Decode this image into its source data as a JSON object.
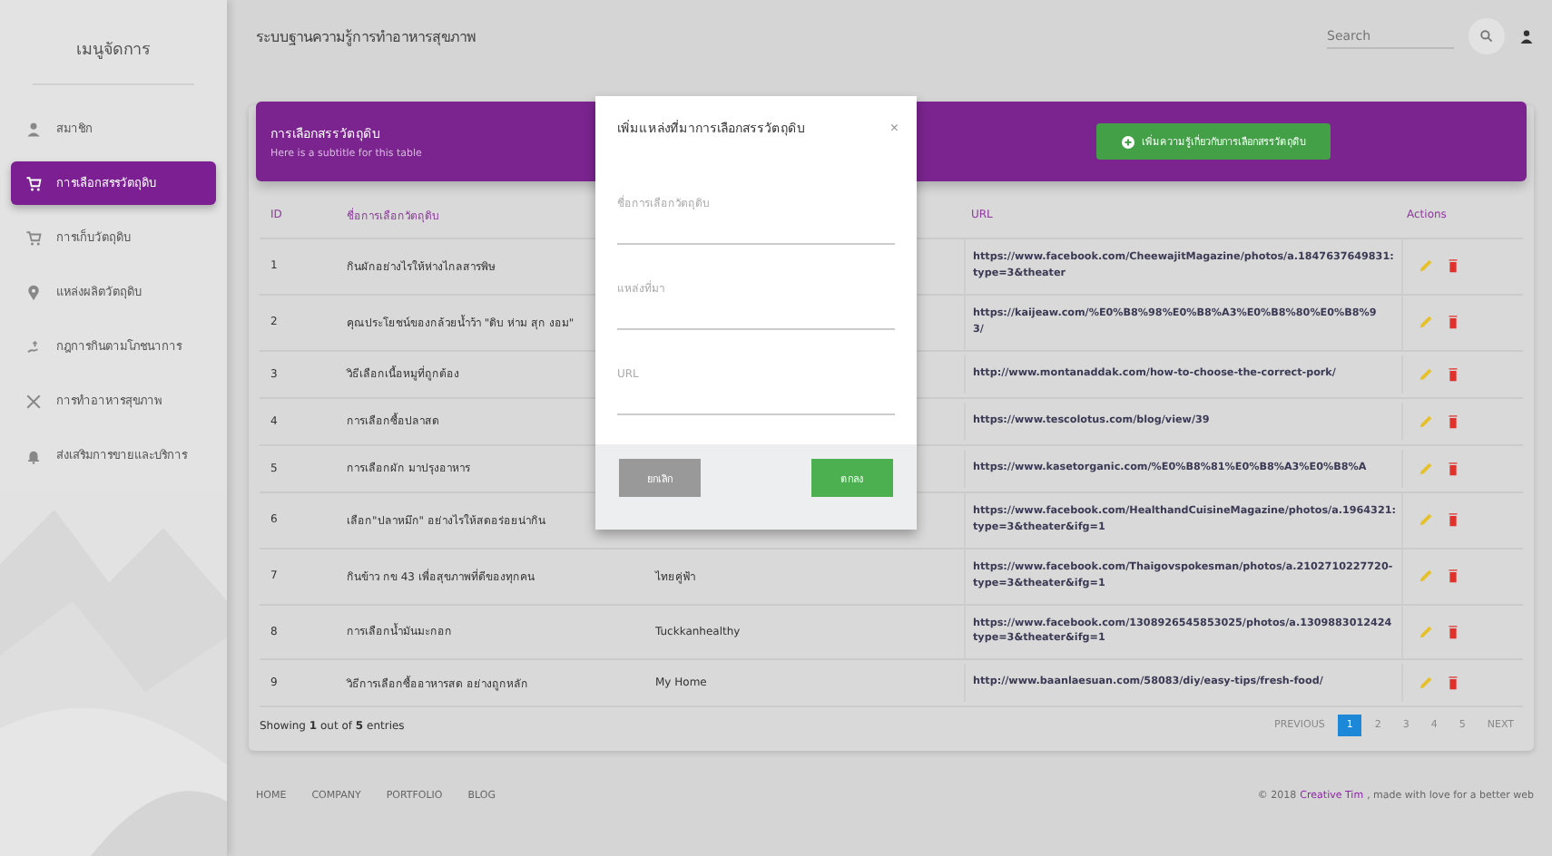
{
  "sidebar": {
    "title": "เมนูจัดการ",
    "items": [
      {
        "label": "สมาชิก",
        "selected": false
      },
      {
        "label": "การเลือกสรรวัตถุดิบ",
        "selected": true
      },
      {
        "label": "การเก็บวัตถุดิบ",
        "selected": false
      },
      {
        "label": "แหล่งผลิตวัตถุดิบ",
        "selected": false
      },
      {
        "label": "กฎการกินตามโภชนาการ",
        "selected": false
      },
      {
        "label": "การทำอาหารสุขภาพ",
        "selected": false
      },
      {
        "label": "ส่งเสริมการขายและบริการ",
        "selected": false
      }
    ]
  },
  "header": {
    "title": "ระบบฐานความรู้การทำอาหารสุขภาพ",
    "search": {
      "placeholder": "Search"
    }
  },
  "card": {
    "title": "การเลือกสรรวัตถุดิบ",
    "subtitle": "Here is a subtitle for this table",
    "add_button": "เพิ่มความรู้เกี่ยวกับการเลือกสรรวัตถุดิบ",
    "columns": [
      "ID",
      "ชื่อการเลือกวัตถุดิบ",
      "URL",
      "Actions"
    ],
    "rows": [
      {
        "id": "1",
        "name": "กินผักอย่างไรให้ห่างไกลสารพิษ",
        "url_lines": [
          "https://www.facebook.com/CheewajitMagazine/photos/a.1847637649831:",
          "type=3&theater"
        ]
      },
      {
        "id": "2",
        "name": "คุณประโยชน์ของกล้วยน้ำว้า \"ดิบ ห่าม สุก งอม\"",
        "url_lines": [
          "https://kaijeaw.com/%E0%B8%98%E0%B8%A3%E0%B8%80%E0%B8%9",
          "3/"
        ]
      },
      {
        "id": "3",
        "name": "วิธีเลือกเนื้อหมูที่ถูกต้อง",
        "url_lines": [
          "http://www.montanaddak.com/how-to-choose-the-correct-pork/"
        ]
      },
      {
        "id": "4",
        "name": "การเลือกซื้อปลาสด",
        "url_lines": [
          "https://www.tescolotus.com/blog/view/39"
        ]
      },
      {
        "id": "5",
        "name": "การเลือกผัก มาปรุงอาหาร",
        "url_lines": [
          "https://www.kasetorganic.com/%E0%B8%81%E0%B8%A3%E0%B8%A"
        ]
      },
      {
        "id": "6",
        "name": "เลือก\"ปลาหมึก\" อย่างไรให้สดอร่อยน่ากิน",
        "url_lines": [
          "https://www.facebook.com/HealthandCuisineMagazine/photos/a.1964321:",
          "type=3&theater&ifg=1"
        ]
      },
      {
        "id": "7",
        "name": "กินข้าว กข 43 เพื่อสุขภาพที่ดีของทุกคน",
        "source": "ไทยคู่ฟ้า",
        "url_lines": [
          "https://www.facebook.com/Thaigovspokesman/photos/a.2102710227720-",
          "type=3&theater&ifg=1"
        ]
      },
      {
        "id": "8",
        "name": "การเลือกน้ำมันมะกอก",
        "source": "Tuckkanhealthy",
        "url_lines": [
          "https://www.facebook.com/1308926545853025/photos/a.1309883012424",
          "type=3&theater&ifg=1"
        ]
      },
      {
        "id": "9",
        "name": "วิธีการเลือกซื้ออาหารสด อย่างถูกหลัก",
        "source": "My Home",
        "url_lines": [
          "http://www.baanlaesuan.com/58083/diy/easy-tips/fresh-food/"
        ]
      }
    ],
    "entries": "Showing **1** out of **5** entries",
    "pagination": [
      {
        "label": "PREVIOUS",
        "selected": false
      },
      {
        "label": "1",
        "selected": true
      },
      {
        "label": "2",
        "selected": false
      },
      {
        "label": "3",
        "selected": false
      },
      {
        "label": "4",
        "selected": false
      },
      {
        "label": "5",
        "selected": false
      },
      {
        "label": "NEXT",
        "selected": false
      }
    ]
  },
  "modal": {
    "title": "เพิ่มแหล่งที่มาการเลือกสรรวัตถุดิบ",
    "close": "×",
    "fields": [
      {
        "placeholder": "ชื่อการเลือกวัตถุดิบ"
      },
      {
        "placeholder": "แหล่งที่มา"
      },
      {
        "placeholder": "URL"
      }
    ],
    "cancel": "ยกเลิก",
    "ok": "ตกลง"
  },
  "footer": {
    "links": [
      "HOME",
      "COMPANY",
      "PORTFOLIO",
      "BLOG"
    ],
    "copyright_start": "© 2018",
    "copyright_link": "Creative Tim",
    "copyright_end": ", made with love for a better web"
  }
}
